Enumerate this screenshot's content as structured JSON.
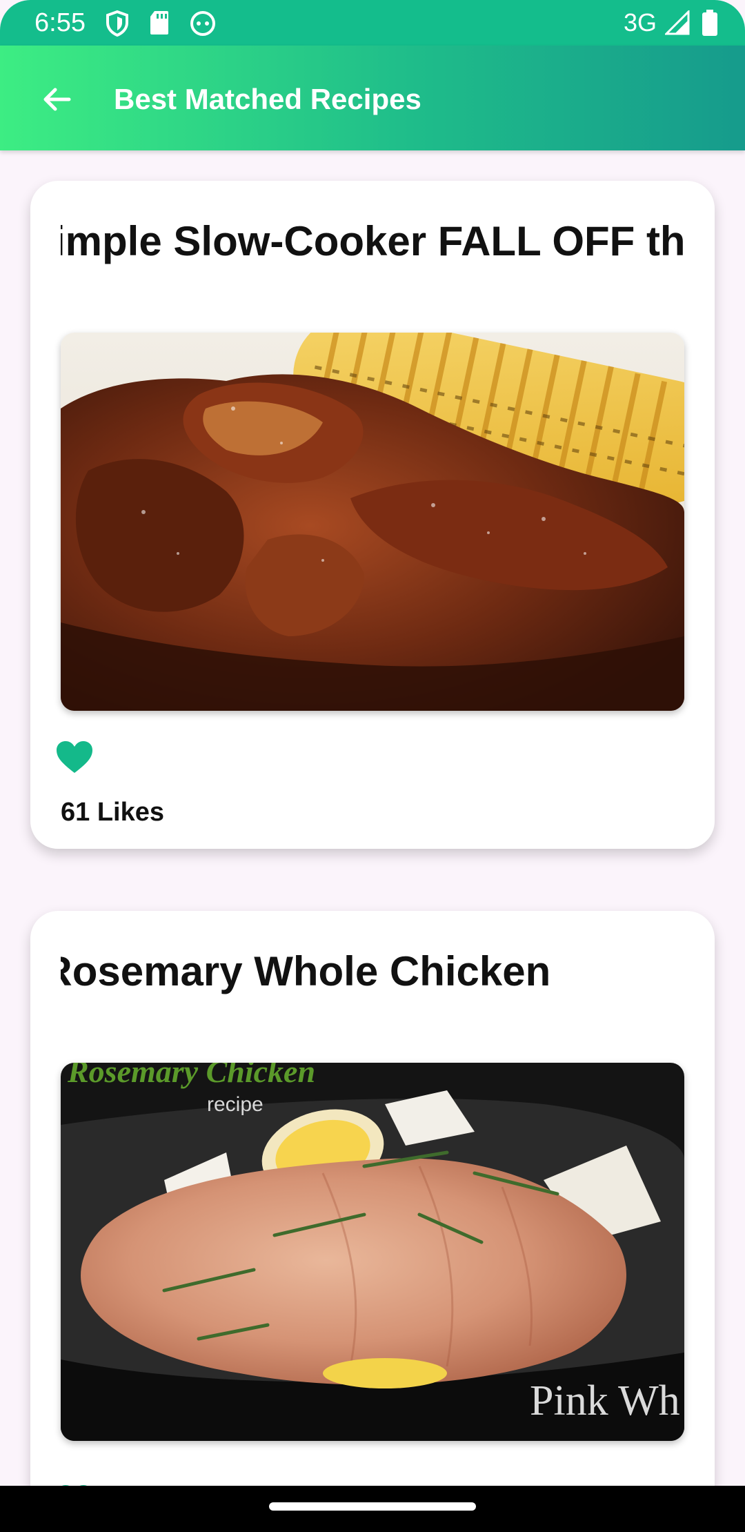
{
  "status_bar": {
    "time": "6:55",
    "network": "3G",
    "icons": [
      "shield-icon",
      "sd-card-icon",
      "android-debug-icon",
      "signal-icon",
      "battery-icon"
    ]
  },
  "app_bar": {
    "title": "Best Matched Recipes",
    "back_icon": "arrow-back-icon"
  },
  "colors": {
    "status_bar": "#14bd8c",
    "app_bar_start": "#3ded83",
    "app_bar_end": "#169b8c",
    "heart": "#14b98a",
    "background": "#fbf4fb"
  },
  "recipes": [
    {
      "title": "imple Slow-Cooker FALL OFF th",
      "image_icon": "ribs-and-corn-photo",
      "likes": "61 Likes",
      "heart_icon": "heart-icon"
    },
    {
      "title": "oker Rosemary Whole Chicken",
      "image_icon": "rosemary-chicken-photo",
      "image_caption_title": "Rosemary Chicken",
      "image_caption_sub": "recipe",
      "image_watermark": "Pink Wh",
      "heart_icon": "heart-icon"
    }
  ]
}
